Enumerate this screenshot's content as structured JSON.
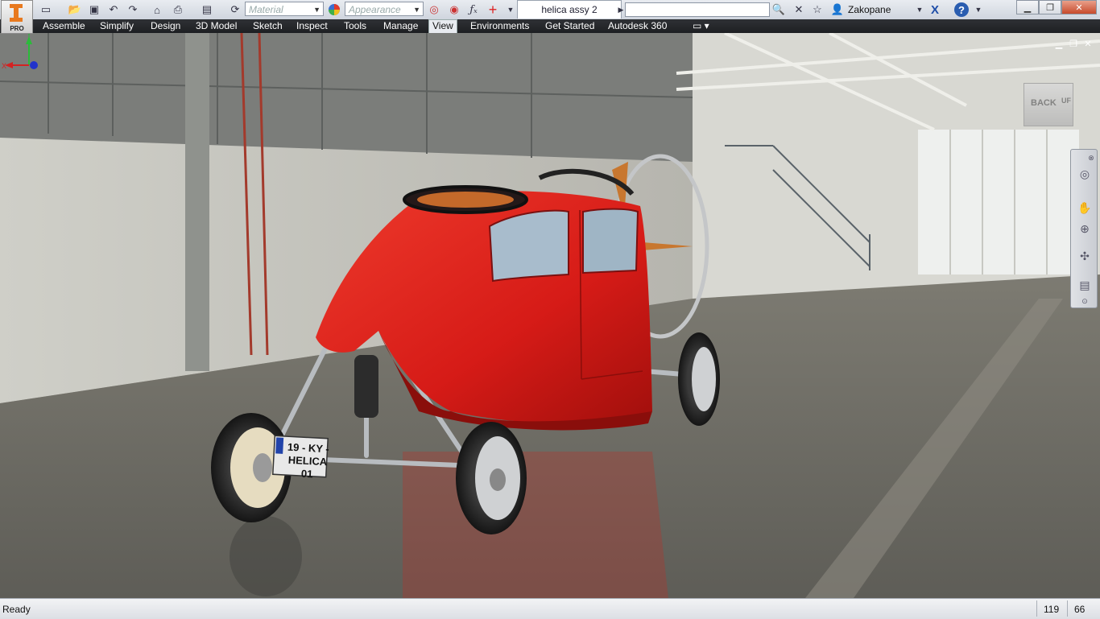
{
  "app": {
    "edition_badge": "PRO",
    "document_tab": "helica assy 2",
    "user_name": "Zakopane"
  },
  "toolbar": {
    "material_placeholder": "Material",
    "appearance_placeholder": "Appearance",
    "search_value": ""
  },
  "ribbon": {
    "tabs": [
      {
        "label": "Assemble",
        "active": false
      },
      {
        "label": "Simplify",
        "active": false
      },
      {
        "label": "Design",
        "active": false
      },
      {
        "label": "3D Model",
        "active": false
      },
      {
        "label": "Sketch",
        "active": false
      },
      {
        "label": "Inspect",
        "active": false
      },
      {
        "label": "Tools",
        "active": false
      },
      {
        "label": "Manage",
        "active": false
      },
      {
        "label": "View",
        "active": true
      },
      {
        "label": "Environments",
        "active": false
      },
      {
        "label": "Get Started",
        "active": false
      },
      {
        "label": "Autodesk 360",
        "active": false
      }
    ]
  },
  "viewport": {
    "viewcube_face": "BACK",
    "viewcube_side": "UF",
    "license_plate_line1": "19 - KY -",
    "license_plate_line2": "HELICA 01",
    "triad": {
      "x": "X",
      "y": "Y"
    }
  },
  "statusbar": {
    "text": "Ready",
    "num1": "119",
    "num2": "66"
  },
  "colors": {
    "car_body": "#d61b17",
    "ribbon_bg": "#26282c",
    "floor": "#6e6d66"
  }
}
